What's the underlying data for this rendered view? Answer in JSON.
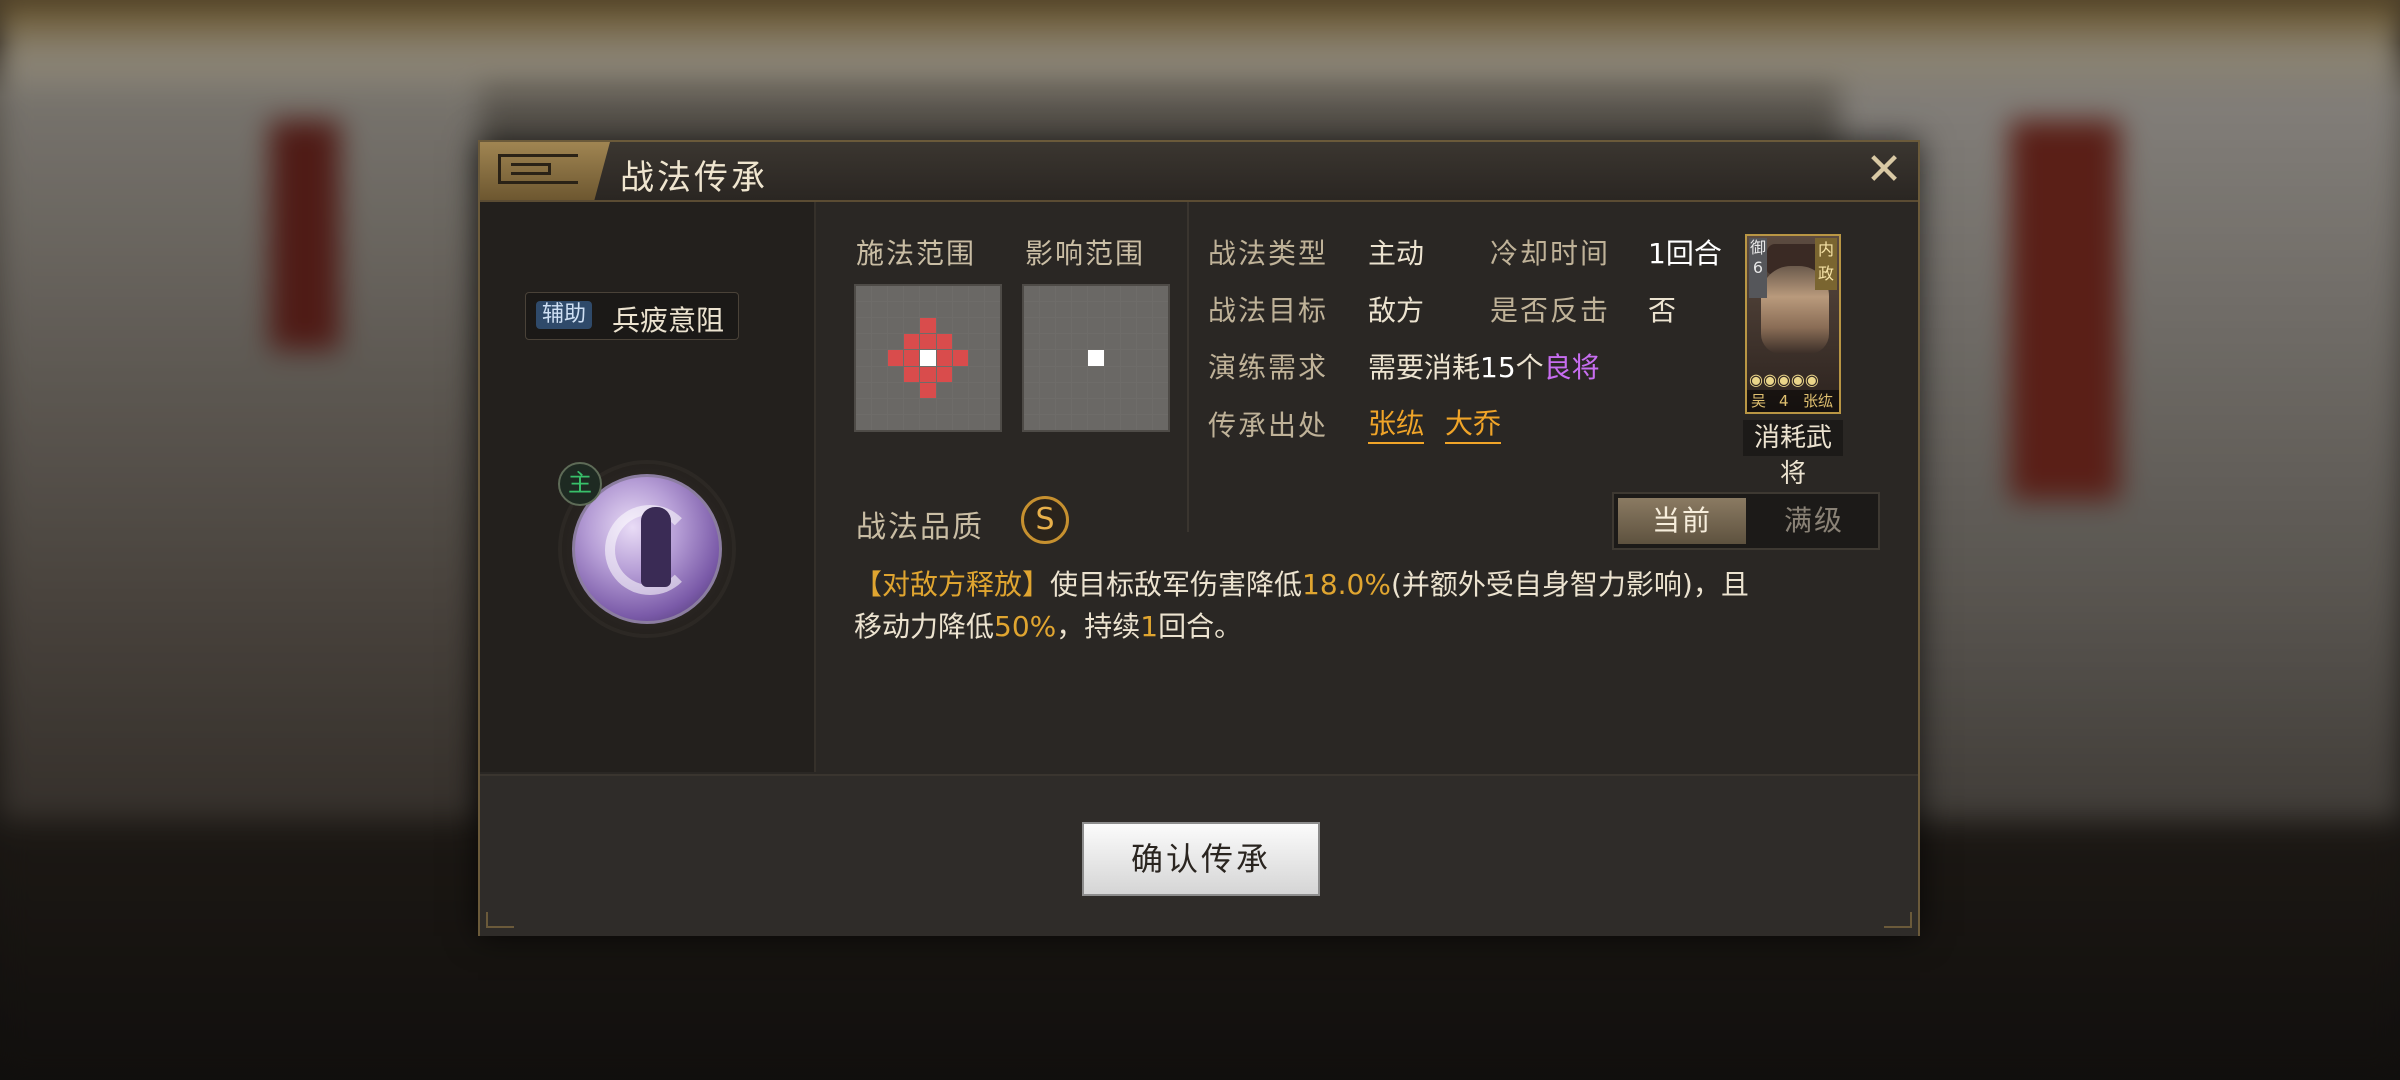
{
  "dialog": {
    "title": "战法传承",
    "close_icon": "close-icon"
  },
  "skill": {
    "type_badge": "辅助",
    "name": "兵疲意阻",
    "zhu_badge": "主",
    "icon": "purple-swirl-skill-icon"
  },
  "ranges": {
    "cast_label": "施法范围",
    "effect_label": "影响范围"
  },
  "info": {
    "type_label": "战法类型",
    "type_value": "主动",
    "cooldown_label": "冷却时间",
    "cooldown_value": "1回合",
    "target_label": "战法目标",
    "target_value": "敌方",
    "counter_label": "是否反击",
    "counter_value": "否",
    "train_label": "演练需求",
    "train_prefix": "需要消耗",
    "train_num": "15",
    "train_unit": "个",
    "train_item": "良将",
    "source_label": "传承出处",
    "source_1": "张纮",
    "source_2": "大乔"
  },
  "general": {
    "tag_left": "御6",
    "tag_right": "内政",
    "stars": "◉◉◉◉◉",
    "faction": "吴",
    "cost": "4",
    "name": "张纮",
    "caption": "消耗武将"
  },
  "quality": {
    "label": "战法品质",
    "grade": "S"
  },
  "toggle": {
    "current": "当前",
    "max": "满级"
  },
  "description": {
    "tag": "【对敌方释放】",
    "part1": "使目标敌军伤害降低",
    "val1": "18.0%",
    "part2": "(并额外受自身智力影响)，且",
    "part3": "移动力降低",
    "val2": "50%",
    "part4": "，持续",
    "val3": "1",
    "part5": "回合。"
  },
  "footer": {
    "confirm": "确认传承"
  },
  "colors": {
    "accent_gold": "#e0a530",
    "link_orange": "#f0a428",
    "purple": "#c76df0",
    "range_red": "#d94c4c"
  }
}
